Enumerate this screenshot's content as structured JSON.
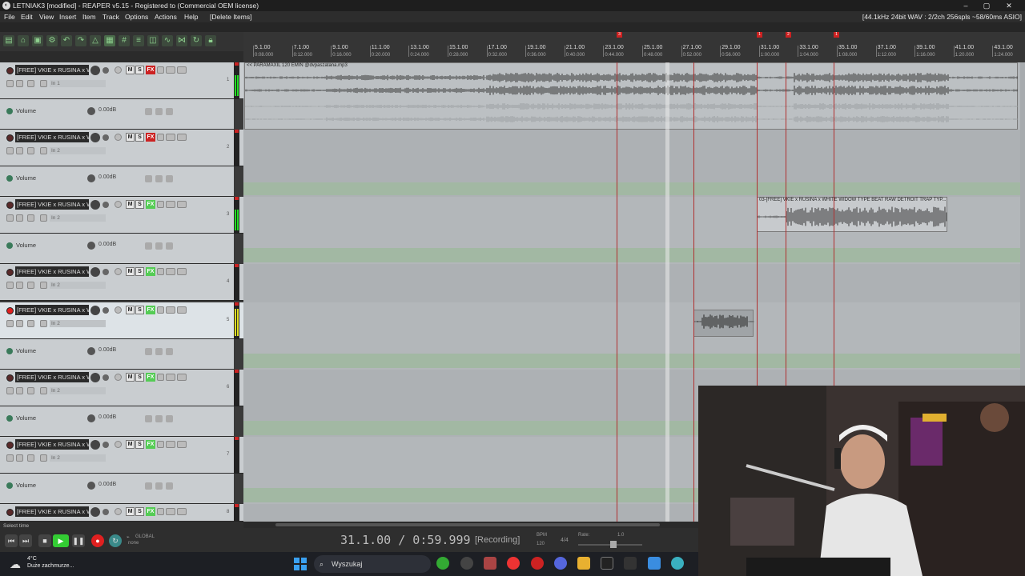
{
  "window": {
    "title": "LETNIAK3 [modified] - REAPER v5.15 - Registered to  (Commercial OEM license)",
    "app_icon": "reaper-icon",
    "minimize": "–",
    "maximize": "▢",
    "close": "✕"
  },
  "menu": {
    "items": [
      "File",
      "Edit",
      "View",
      "Insert",
      "Item",
      "Track",
      "Options",
      "Actions",
      "Help",
      "[Delete Items]"
    ],
    "status": "[44.1kHz 24bit WAV : 2/2ch 256spls ~58/60ms ASIO]"
  },
  "ruler": {
    "labels": [
      {
        "bar": "5.1.00",
        "time": "0:08.000"
      },
      {
        "bar": "7.1.00",
        "time": "0:12.000"
      },
      {
        "bar": "9.1.00",
        "time": "0:16.000"
      },
      {
        "bar": "11.1.00",
        "time": "0:20.000"
      },
      {
        "bar": "13.1.00",
        "time": "0:24.000"
      },
      {
        "bar": "15.1.00",
        "time": "0:28.000"
      },
      {
        "bar": "17.1.00",
        "time": "0:32.000"
      },
      {
        "bar": "19.1.00",
        "time": "0:36.000"
      },
      {
        "bar": "21.1.00",
        "time": "0:40.000"
      },
      {
        "bar": "23.1.00",
        "time": "0:44.000"
      },
      {
        "bar": "25.1.00",
        "time": "0:48.000"
      },
      {
        "bar": "27.1.00",
        "time": "0:52.000"
      },
      {
        "bar": "29.1.00",
        "time": "0:56.000"
      },
      {
        "bar": "31.1.00",
        "time": "1:00.000"
      },
      {
        "bar": "33.1.00",
        "time": "1:04.000"
      },
      {
        "bar": "35.1.00",
        "time": "1:08.000"
      },
      {
        "bar": "37.1.00",
        "time": "1:12.000"
      },
      {
        "bar": "39.1.00",
        "time": "1:16.000"
      },
      {
        "bar": "41.1.00",
        "time": "1:20.000"
      },
      {
        "bar": "43.1.00",
        "time": "1:24.000"
      }
    ],
    "markers": [
      "3",
      "1",
      "2",
      "1"
    ]
  },
  "tracks": [
    {
      "name": "[FREE] VKIE x RUSINA x W",
      "input": "In 1",
      "fx": "FX",
      "fx_color": "red",
      "number": "1",
      "selected": false
    },
    {
      "name": "[FREE] VKIE x RUSINA x W",
      "input": "In 2",
      "fx": "FX",
      "fx_color": "red",
      "number": "2",
      "selected": false
    },
    {
      "name": "[FREE] VKIE x RUSINA x W",
      "input": "In 2",
      "fx": "FX",
      "fx_color": "green",
      "number": "3",
      "selected": false
    },
    {
      "name": "[FREE] VKIE x RUSINA x W",
      "input": "In 2",
      "fx": "FX",
      "fx_color": "green",
      "number": "4",
      "selected": false
    },
    {
      "name": "[FREE] VKIE x RUSINA x W",
      "input": "In 2",
      "fx": "FX",
      "fx_color": "green",
      "number": "5",
      "selected": true
    },
    {
      "name": "[FREE] VKIE x RUSINA x W",
      "input": "In 2",
      "fx": "FX",
      "fx_color": "green",
      "number": "6",
      "selected": false
    },
    {
      "name": "[FREE] VKIE x RUSINA x W",
      "input": "In 2",
      "fx": "FX",
      "fx_color": "green",
      "number": "7",
      "selected": false
    },
    {
      "name": "[FREE] VKIE x RUSINA x W",
      "input": "",
      "fx": "FX",
      "fx_color": "green",
      "number": "8",
      "selected": false
    }
  ],
  "track_buttons": {
    "mute": "M",
    "solo": "S"
  },
  "envelope": {
    "label": "Volume",
    "value": "0.00dB"
  },
  "items": {
    "top_item": "<< PARAMAXIL 120 EMIN @dvpaszatana.mp3",
    "beat_item": "03-[FREE] VKIE x RUSINA x WHITE WIDOW TYPE BEAT  RAW  DETROIT TRAP TYP..."
  },
  "transport": {
    "status_text": "Select time",
    "position": "31.1.00 / 0:59.999",
    "state": "[Recording]",
    "bpm_label": "BPM",
    "bpm": "120",
    "time_sig": "4/4",
    "rate_label": "Rate:",
    "rate": "1.0",
    "global_label": "GLOBAL",
    "global_sub": "none"
  },
  "taskbar": {
    "temp": "4°C",
    "weather": "Duże zachmurze...",
    "search": "Wyszukaj"
  },
  "colors": {
    "accent_green": "#5c5",
    "record_red": "#e02020",
    "marker_red": "#b03030"
  }
}
